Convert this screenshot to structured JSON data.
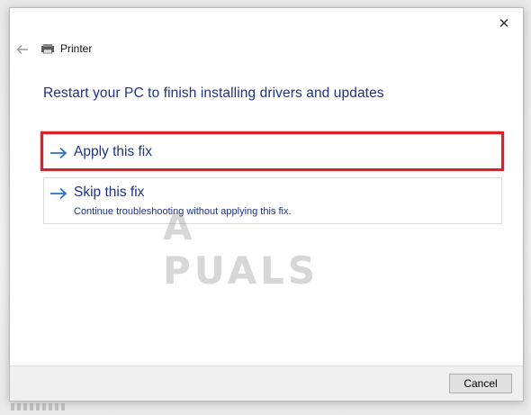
{
  "window": {
    "title": "Printer",
    "close_glyph": "✕",
    "back_icon": "back-arrow-icon",
    "title_icon": "printer-icon"
  },
  "main": {
    "heading": "Restart your PC to finish installing drivers and updates",
    "options": [
      {
        "title": "Apply this fix",
        "subtitle": "",
        "icon": "arrow-right-icon",
        "highlighted": true
      },
      {
        "title": "Skip this fix",
        "subtitle": "Continue troubleshooting without applying this fix.",
        "icon": "arrow-right-icon",
        "highlighted": false
      }
    ]
  },
  "watermark": {
    "text": "A PUALS"
  },
  "footer": {
    "cancel_label": "Cancel"
  },
  "colors": {
    "link_blue": "#1e3287",
    "arrow_blue": "#2a6fc9",
    "highlight_red": "#d6222a"
  }
}
